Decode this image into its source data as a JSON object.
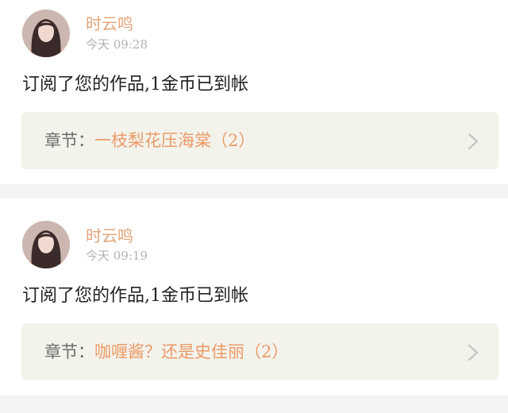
{
  "notifications": [
    {
      "username": "时云鸣",
      "time": "今天 09:28",
      "message": "订阅了您的作品,1金币已到帐",
      "chapter_prefix": "章节：",
      "chapter_title": "一枝梨花压海棠（2）",
      "avatar_icon": "user-avatar",
      "chevron_icon": "chevron-right-icon"
    },
    {
      "username": "时云鸣",
      "time": "今天 09:19",
      "message": "订阅了您的作品,1金币已到帐",
      "chapter_prefix": "章节：",
      "chapter_title": "咖喱酱？还是史佳丽（2）",
      "avatar_icon": "user-avatar",
      "chevron_icon": "chevron-right-icon"
    }
  ],
  "colors": {
    "accent": "#e3a47a",
    "chapter_title": "#ec9a67",
    "text": "#222222",
    "muted": "#b2b2b2",
    "chapter_bg": "#f3f3ec",
    "page_bg": "#f4f4f4"
  }
}
